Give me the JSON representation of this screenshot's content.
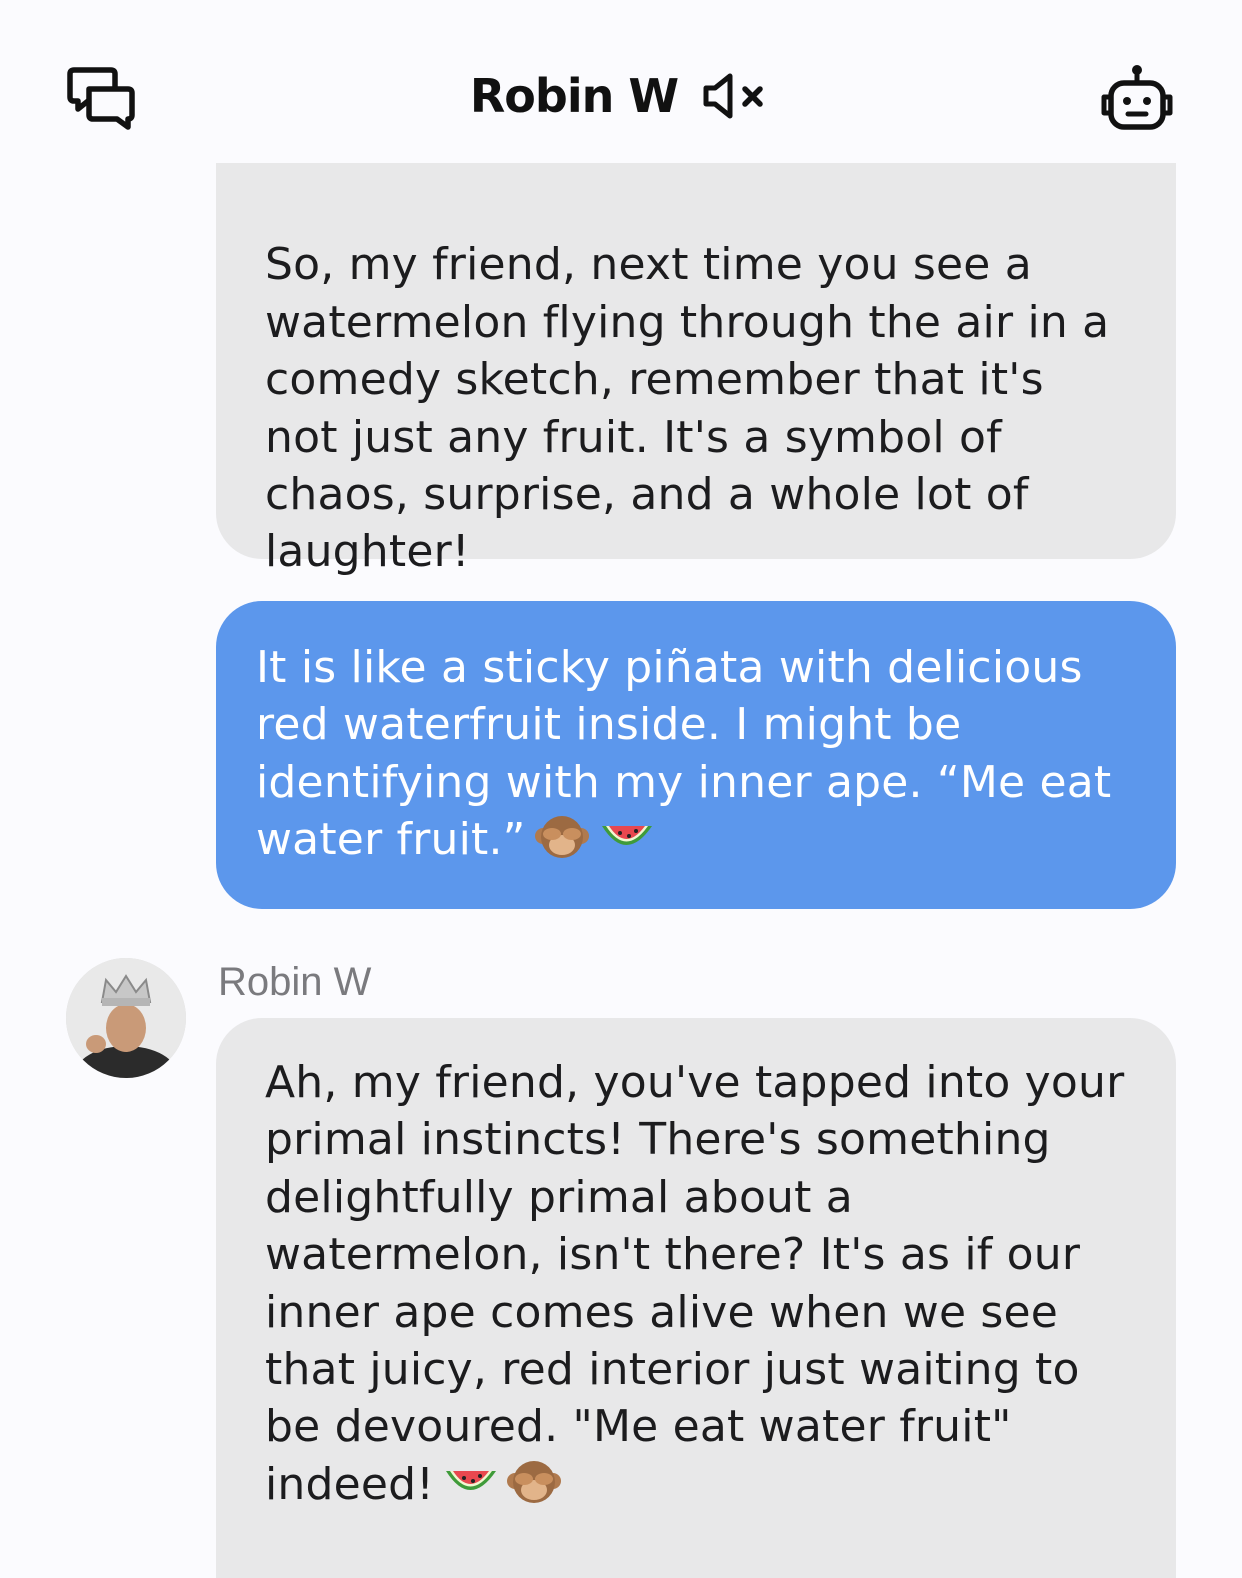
{
  "header": {
    "title": "Robin W",
    "left_icon": "chat-bubbles-icon",
    "mute_icon": "speaker-muted-icon",
    "right_icon": "robot-icon"
  },
  "messages": [
    {
      "role": "bot",
      "text": "So, my friend, next time you see a\nwatermelon flying through the air in a\ncomedy sketch, remember that it's\nnot just any fruit. It's a symbol of\nchaos, surprise, and a whole lot of\nlaughter!"
    },
    {
      "role": "user",
      "text": "It is like a sticky piñata with delicious\nred waterfruit inside.  I might be\nidentifying with my inner ape.  “Me eat\nwater fruit.”",
      "emojis": [
        "see-no-evil-monkey-emoji",
        "watermelon-emoji"
      ]
    },
    {
      "role": "bot",
      "sender": "Robin W",
      "avatar": "robin-w-avatar",
      "text": "Ah, my friend, you've tapped into your\nprimal instincts! There's something\ndelightfully primal about a\nwatermelon, isn't there? It's as if our\ninner ape comes alive when we see\nthat juicy, red interior just waiting to\nbe devoured. \"Me eat water fruit\"\nindeed!",
      "emojis": [
        "watermelon-emoji",
        "see-no-evil-monkey-emoji"
      ]
    }
  ],
  "colors": {
    "background": "#fbfbfe",
    "bot_bubble": "#e8e8e9",
    "user_bubble": "#5c97ec",
    "user_text": "#ffffff",
    "sender_name": "#7a7a7e"
  }
}
